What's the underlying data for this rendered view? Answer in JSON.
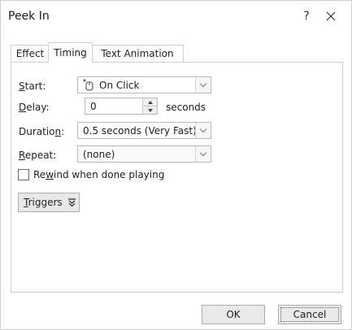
{
  "dialog": {
    "title": "Peek In",
    "help_label": "?",
    "close_label": "×"
  },
  "tabs": [
    {
      "label": "Effect",
      "active": false
    },
    {
      "label": "Timing",
      "active": true
    },
    {
      "label": "Text Animation",
      "active": false
    }
  ],
  "timing": {
    "start": {
      "label": "Start:",
      "access_key": "S",
      "label_rest": "tart:",
      "value": "On Click",
      "icon": "mouse-click-icon"
    },
    "delay": {
      "label": "Delay:",
      "access_key": "D",
      "label_rest": "elay:",
      "value": "0",
      "unit": "seconds"
    },
    "duration": {
      "label": "Duration:",
      "label_pre": "Duratio",
      "access_key": "n",
      "label_post": ":",
      "value": "0.5 seconds (Very Fast)"
    },
    "repeat": {
      "label": "Repeat:",
      "access_key": "R",
      "label_rest": "epeat:",
      "value": "(none)"
    },
    "rewind": {
      "label": "Rewind when done playing",
      "label_pre": "Re",
      "access_key": "w",
      "label_post": "ind when done playing",
      "checked": false
    },
    "triggers": {
      "label": "Triggers",
      "access_key": "T",
      "label_rest": "riggers",
      "icon": "chevron-double-down-icon"
    }
  },
  "footer": {
    "ok_label": "OK",
    "cancel_label": "Cancel"
  }
}
